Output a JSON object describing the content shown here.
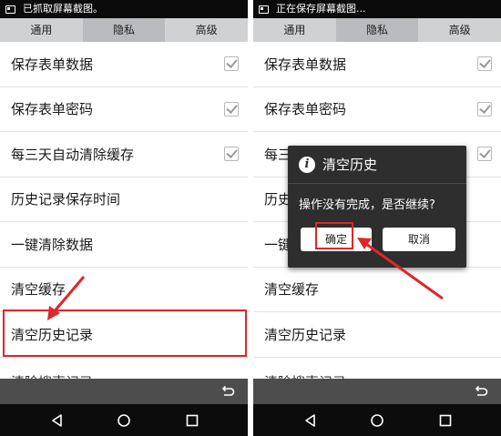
{
  "left": {
    "status_text": "已抓取屏幕截图。",
    "tabs": [
      {
        "label": "通用"
      },
      {
        "label": "隐私"
      },
      {
        "label": "高级"
      }
    ],
    "rows": [
      {
        "label": "保存表单数据",
        "checked": true
      },
      {
        "label": "保存表单密码",
        "checked": true
      },
      {
        "label": "每三天自动清除缓存",
        "checked": true
      },
      {
        "label": "历史记录保存时间",
        "checked": false
      },
      {
        "label": "一键清除数据",
        "checked": false
      },
      {
        "label": "清空缓存",
        "checked": false
      },
      {
        "label": "清空历史记录",
        "checked": false
      },
      {
        "label": "清除搜索记录",
        "checked": false
      }
    ]
  },
  "right": {
    "status_text": "正在保存屏幕截图...",
    "tabs": [
      {
        "label": "通用"
      },
      {
        "label": "隐私"
      },
      {
        "label": "高级"
      }
    ],
    "rows": [
      {
        "label": "保存表单数据",
        "checked": true
      },
      {
        "label": "保存表单密码",
        "checked": true
      },
      {
        "label": "每三",
        "checked": true
      },
      {
        "label": "历史",
        "checked": false
      },
      {
        "label": "一键",
        "checked": false
      },
      {
        "label": "清空缓存",
        "checked": false
      },
      {
        "label": "清空历史记录",
        "checked": false
      },
      {
        "label": "清除搜索记录",
        "checked": false
      }
    ],
    "dialog": {
      "title": "清空历史",
      "message": "操作没有完成，是否继续?",
      "ok_label": "确定",
      "cancel_label": "取消"
    }
  },
  "colors": {
    "highlight": "#e0262a",
    "status_bar": "#0b0b0b",
    "tab_bar": "#cfd1d3",
    "tab_active": "#b9bbbe",
    "toolbar": "#4d4d4d",
    "dialog_bg": "#2e2e2e"
  },
  "icons": {
    "screenshot": "screenshot-icon",
    "back_arrow": "back-arrow-icon",
    "nav_back": "nav-back-icon",
    "nav_home": "nav-home-icon",
    "nav_recent": "nav-recent-icon",
    "info": "info-icon"
  }
}
